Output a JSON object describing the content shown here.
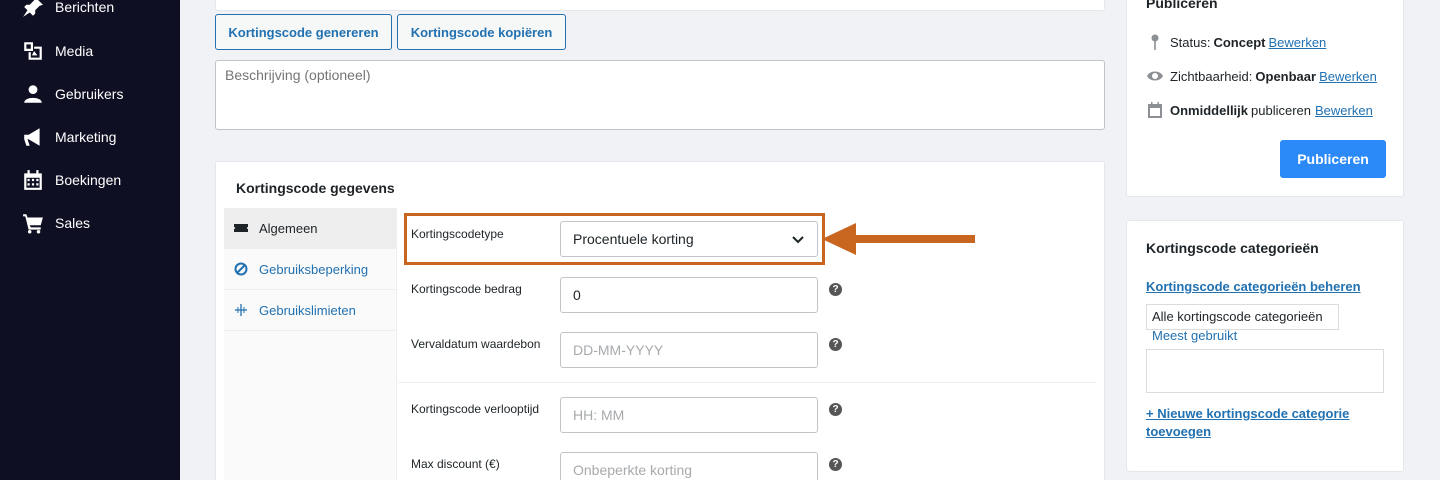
{
  "sidebar": {
    "items": [
      {
        "label": "Berichten",
        "icon": "pin-icon"
      },
      {
        "label": "Media",
        "icon": "media-icon"
      },
      {
        "label": "Gebruikers",
        "icon": "users-icon"
      },
      {
        "label": "Marketing",
        "icon": "megaphone-icon"
      },
      {
        "label": "Boekingen",
        "icon": "calendar-icon"
      },
      {
        "label": "Sales",
        "icon": "cart-icon"
      }
    ]
  },
  "actions": {
    "generate": "Kortingscode genereren",
    "copy": "Kortingscode kopiëren"
  },
  "description": {
    "placeholder": "Beschrijving (optioneel)"
  },
  "coupon_panel": {
    "title": "Kortingscode gegevens",
    "tabs": [
      "Algemeen",
      "Gebruiksbeperking",
      "Gebruikslimieten"
    ],
    "fields": {
      "type": {
        "label": "Kortingscodetype",
        "value": "Procentuele korting"
      },
      "amount": {
        "label": "Kortingscode bedrag",
        "value": "0"
      },
      "expiry_date": {
        "label": "Vervaldatum waardebon",
        "placeholder": "DD-MM-YYYY"
      },
      "expiry_time": {
        "label": "Kortingscode verlooptijd",
        "placeholder": "HH: MM"
      },
      "max_discount": {
        "label": "Max discount (€)",
        "placeholder": "Onbeperkte korting"
      }
    },
    "help_glyph": "?"
  },
  "publish": {
    "title": "Publiceren",
    "status_label": "Status:",
    "status_value": "Concept",
    "visibility_label": "Zichtbaarheid:",
    "visibility_value": "Openbaar",
    "immediately": "Onmiddellijk",
    "publish_text": "publiceren",
    "edit": "Bewerken",
    "publish_button": "Publiceren"
  },
  "categories": {
    "title": "Kortingscode categorieën",
    "manage_link": "Kortingscode categorieën beheren",
    "tab_all": "Alle kortingscode categorieën",
    "tab_most_used": "Meest gebruikt",
    "add_new": "+ Nieuwe kortingscode categorie toevoegen"
  },
  "colors": {
    "sidebar_bg": "#0f0f23",
    "accent": "#2271b1",
    "primary_button": "#2b8af7",
    "highlight": "#c8651f"
  }
}
